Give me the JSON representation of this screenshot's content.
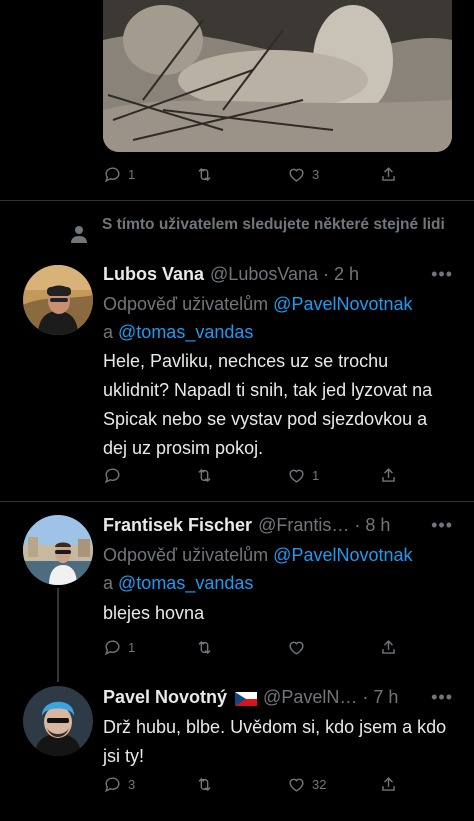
{
  "tweet0": {
    "actions": {
      "replies": "1",
      "retweets": "",
      "likes": "3"
    }
  },
  "social_context": {
    "text": "S tímto uživatelem sledujete některé stejné lidi"
  },
  "tweet1": {
    "name": "Lubos Vana",
    "handle": "@LubosVana · 2 h",
    "reply_prefix": "Odpověď uživatelům",
    "reply_mention1": "@PavelNovotnak",
    "reply_and": "a",
    "reply_mention2": "@tomas_vandas",
    "text": "Hele, Pavliku, nechces uz se trochu uklidnit? Napadl ti snih, tak jed lyzovat na Spicak nebo se vystav pod sjezdovkou a dej uz prosim pokoj.",
    "actions": {
      "replies": "",
      "retweets": "",
      "likes": "1"
    }
  },
  "tweet2": {
    "name": "Frantisek Fischer",
    "handle": "@Frantis… · 8 h",
    "reply_prefix": "Odpověď uživatelům",
    "reply_mention1": "@PavelNovotnak",
    "reply_and": "a",
    "reply_mention2": "@tomas_vandas",
    "text": "blejes hovna",
    "actions": {
      "replies": "1",
      "retweets": "",
      "likes": ""
    }
  },
  "tweet3": {
    "name": "Pavel Novotný",
    "handle": "@PavelN… · 7 h",
    "text": "Drž hubu, blbe. Uvědom si, kdo jsem a kdo jsi ty!",
    "actions": {
      "replies": "3",
      "retweets": "",
      "likes": "32"
    }
  },
  "icons": {
    "reply": "reply-icon",
    "retweet": "retweet-icon",
    "like": "heart-icon",
    "share": "share-icon",
    "more": "more-icon",
    "person": "person-icon",
    "flag": "czech-flag-icon"
  },
  "colors": {
    "background": "#000000",
    "text": "#e7e9ea",
    "muted": "#71767b",
    "link": "#1d9bf0",
    "divider": "#2f3336"
  }
}
